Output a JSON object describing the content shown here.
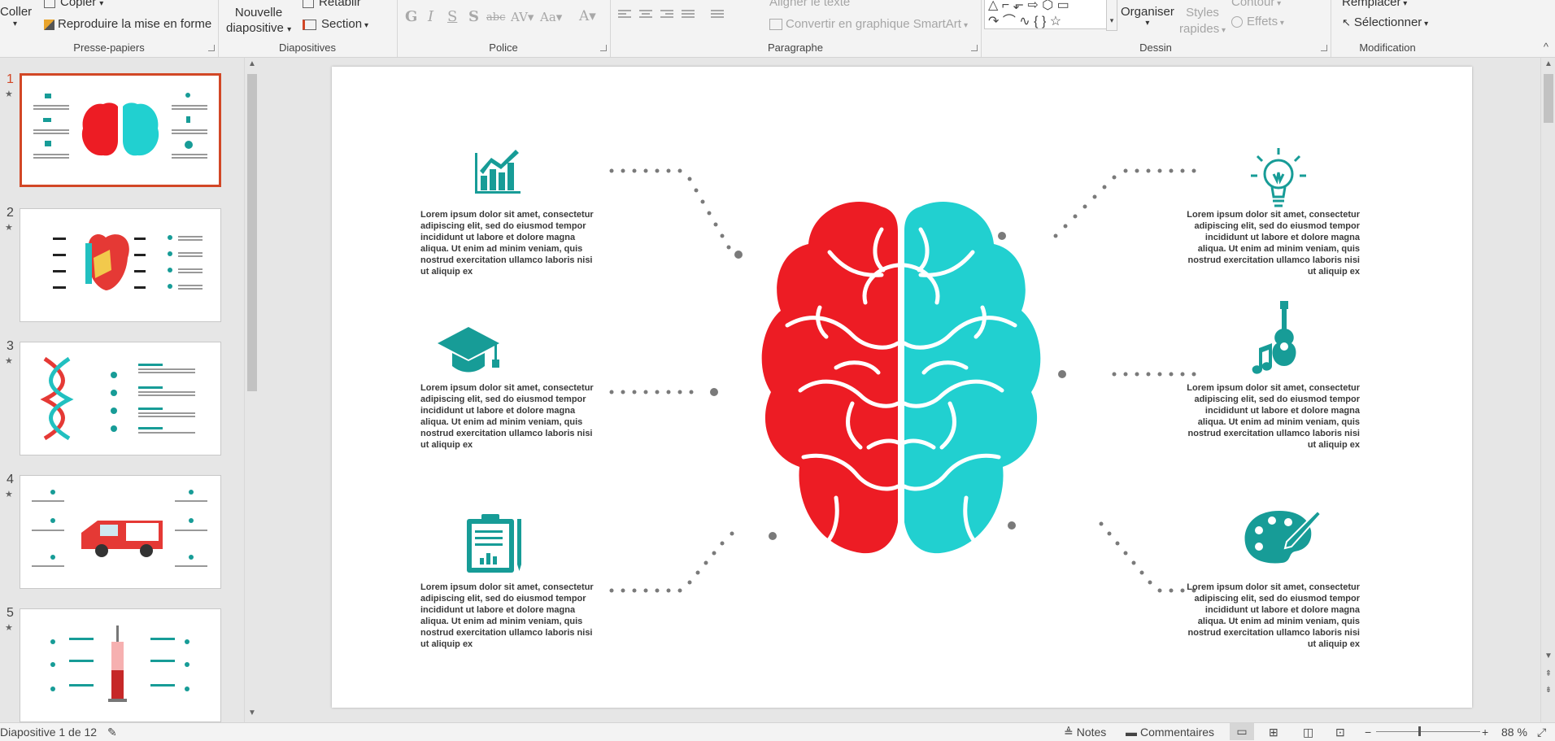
{
  "ribbon": {
    "clipboard": {
      "paste": "Coller",
      "copy": "Copier",
      "format_painter": "Reproduire la mise en forme",
      "label": "Presse-papiers"
    },
    "slides": {
      "new_slide_line1": "Nouvelle",
      "new_slide_line2": "diapositive",
      "reset": "Rétablir",
      "section": "Section",
      "label": "Diapositives"
    },
    "font": {
      "label": "Police"
    },
    "paragraph": {
      "align_text": "Aligner le texte",
      "smartart": "Convertir en graphique SmartArt",
      "label": "Paragraphe"
    },
    "drawing": {
      "arrange": "Organiser",
      "quick_styles_1": "Styles",
      "quick_styles_2": "rapides",
      "outline": "Contour",
      "effects": "Effets",
      "label": "Dessin"
    },
    "editing": {
      "replace": "Remplacer",
      "select": "Sélectionner",
      "label": "Modification"
    }
  },
  "thumbnails": [
    {
      "number": "1",
      "star": "★"
    },
    {
      "number": "2",
      "star": "★"
    },
    {
      "number": "3",
      "star": "★"
    },
    {
      "number": "4",
      "star": "★"
    },
    {
      "number": "5",
      "star": "★"
    }
  ],
  "slide": {
    "texts": [
      "Lorem ipsum dolor sit amet, consectetur adipiscing elit, sed do eiusmod tempor incididunt ut labore et dolore magna aliqua. Ut enim ad minim veniam, quis nostrud exercitation ullamco laboris nisi ut aliquip ex",
      "Lorem ipsum dolor sit amet, consectetur adipiscing elit, sed do eiusmod tempor incididunt ut labore et dolore magna aliqua. Ut enim ad minim veniam, quis nostrud exercitation ullamco laboris nisi ut aliquip ex",
      "Lorem ipsum dolor sit amet, consectetur adipiscing elit, sed do eiusmod tempor incididunt ut labore et dolore magna aliqua. Ut enim ad minim veniam, quis nostrud exercitation ullamco laboris nisi ut aliquip ex",
      "Lorem ipsum dolor sit amet, consectetur adipiscing elit, sed do eiusmod tempor incididunt ut labore et dolore magna aliqua. Ut enim ad minim veniam, quis nostrud exercitation ullamco laboris nisi ut aliquip ex",
      "Lorem ipsum dolor sit amet, consectetur adipiscing elit, sed do eiusmod tempor incididunt ut labore et dolore magna aliqua. Ut enim ad minim veniam, quis nostrud exercitation ullamco laboris nisi ut aliquip ex",
      "Lorem ipsum dolor sit amet, consectetur adipiscing elit, sed do eiusmod tempor incididunt ut labore et dolore magna aliqua. Ut enim ad minim veniam, quis nostrud exercitation ullamco laboris nisi ut aliquip ex"
    ],
    "colors": {
      "left_brain": "#ed1c24",
      "right_brain": "#21d0d0",
      "icon": "#179c97",
      "dots": "#7a7a7a"
    },
    "icons": [
      "chart-icon",
      "graduation-cap-icon",
      "clipboard-icon",
      "lightbulb-icon",
      "music-guitar-icon",
      "palette-icon"
    ]
  },
  "status": {
    "slide_info": "Diapositive 1 de 12",
    "notes": "Notes",
    "comments": "Commentaires",
    "zoom": "88 %"
  }
}
